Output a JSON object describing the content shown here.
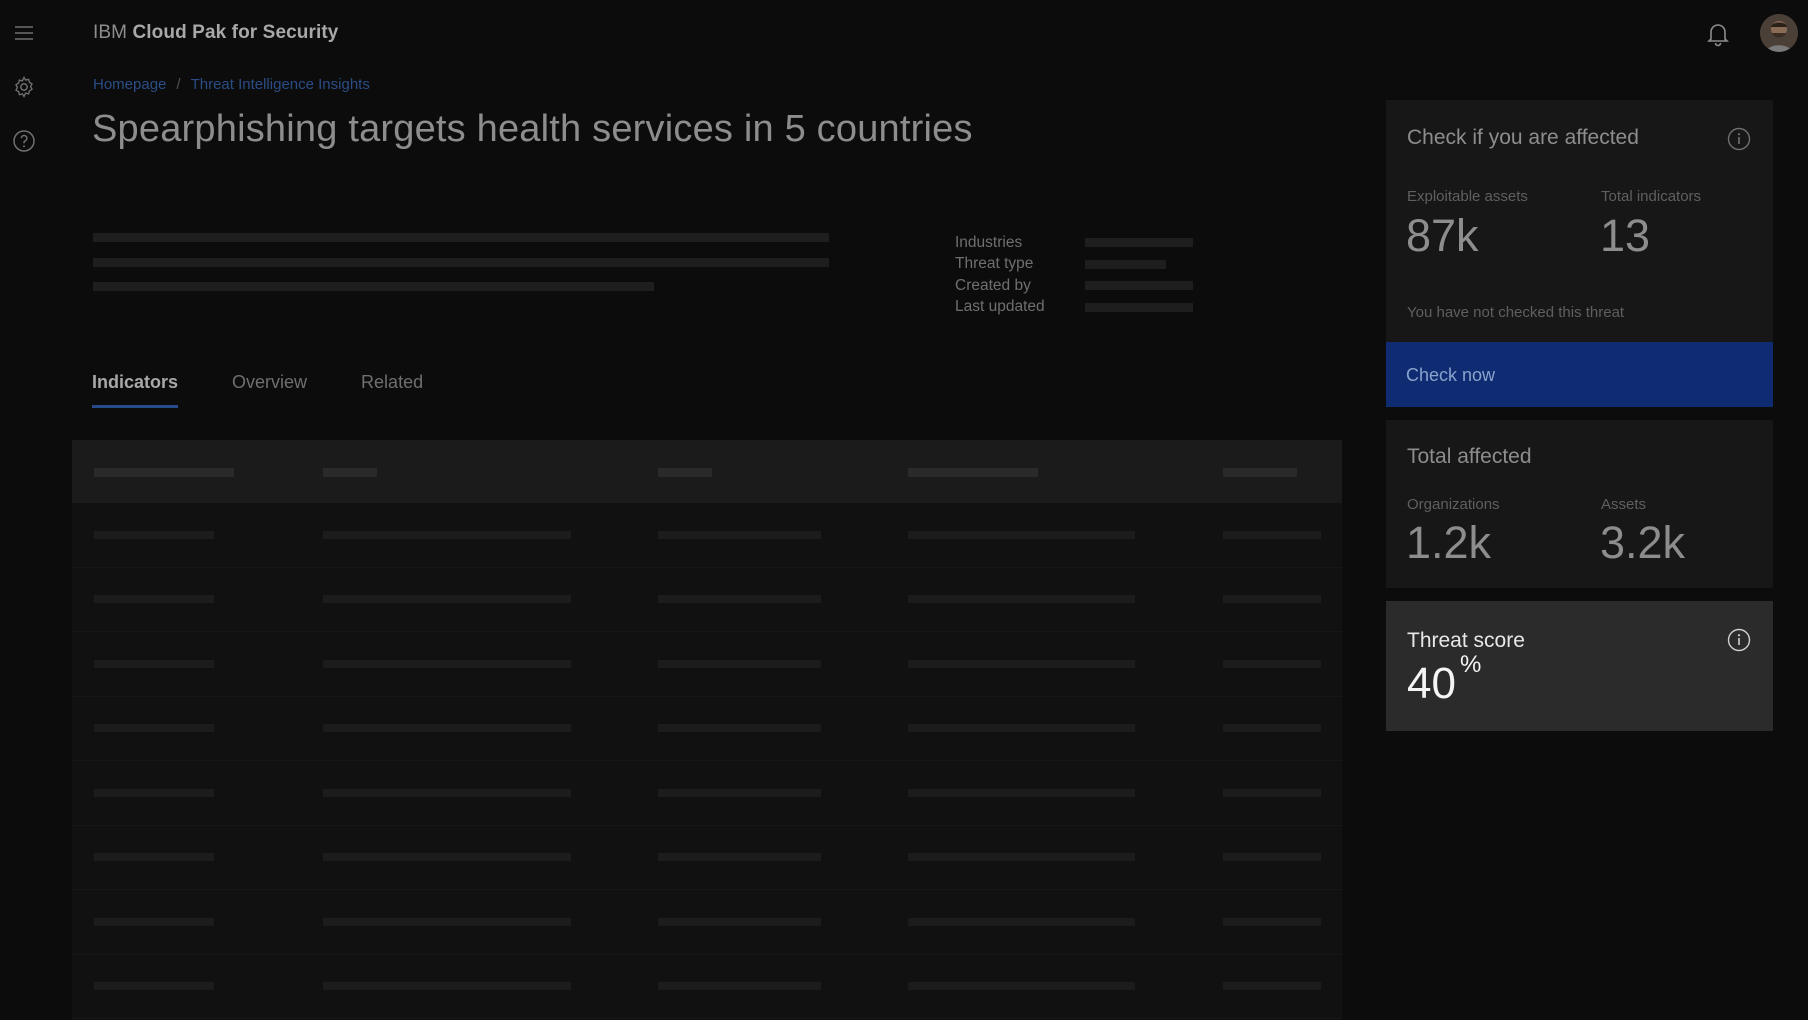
{
  "header": {
    "brand_prefix": "IBM",
    "brand_name": "Cloud Pak for Security",
    "icons": [
      "menu-icon",
      "gear-icon",
      "help-icon",
      "bell-icon",
      "avatar"
    ]
  },
  "breadcrumb": {
    "items": [
      {
        "label": "Homepage"
      },
      {
        "label": "Threat Intelligence Insights"
      }
    ],
    "separator": "/"
  },
  "page": {
    "title": "Spearphishing targets health services in 5 countries"
  },
  "metadata": {
    "labels": [
      "Industries",
      "Threat type",
      "Created by",
      "Last updated"
    ]
  },
  "tabs": [
    {
      "label": "Indicators",
      "active": true
    },
    {
      "label": "Overview",
      "active": false
    },
    {
      "label": "Related",
      "active": false
    }
  ],
  "affected_panel": {
    "title": "Check if you are affected",
    "exploitable_assets_label": "Exploitable assets",
    "exploitable_assets_value": "87k",
    "total_indicators_label": "Total indicators",
    "total_indicators_value": "13",
    "note": "You have not checked this threat",
    "button_label": "Check now"
  },
  "total_affected": {
    "title": "Total affected",
    "organizations_label": "Organizations",
    "organizations_value": "1.2k",
    "assets_label": "Assets",
    "assets_value": "3.2k"
  },
  "threat_score": {
    "title": "Threat score",
    "value": "40",
    "unit": "%"
  },
  "colors": {
    "background": "#0c0c0c",
    "accent_blue": "#0f2c72",
    "link": "#2b4d86"
  }
}
